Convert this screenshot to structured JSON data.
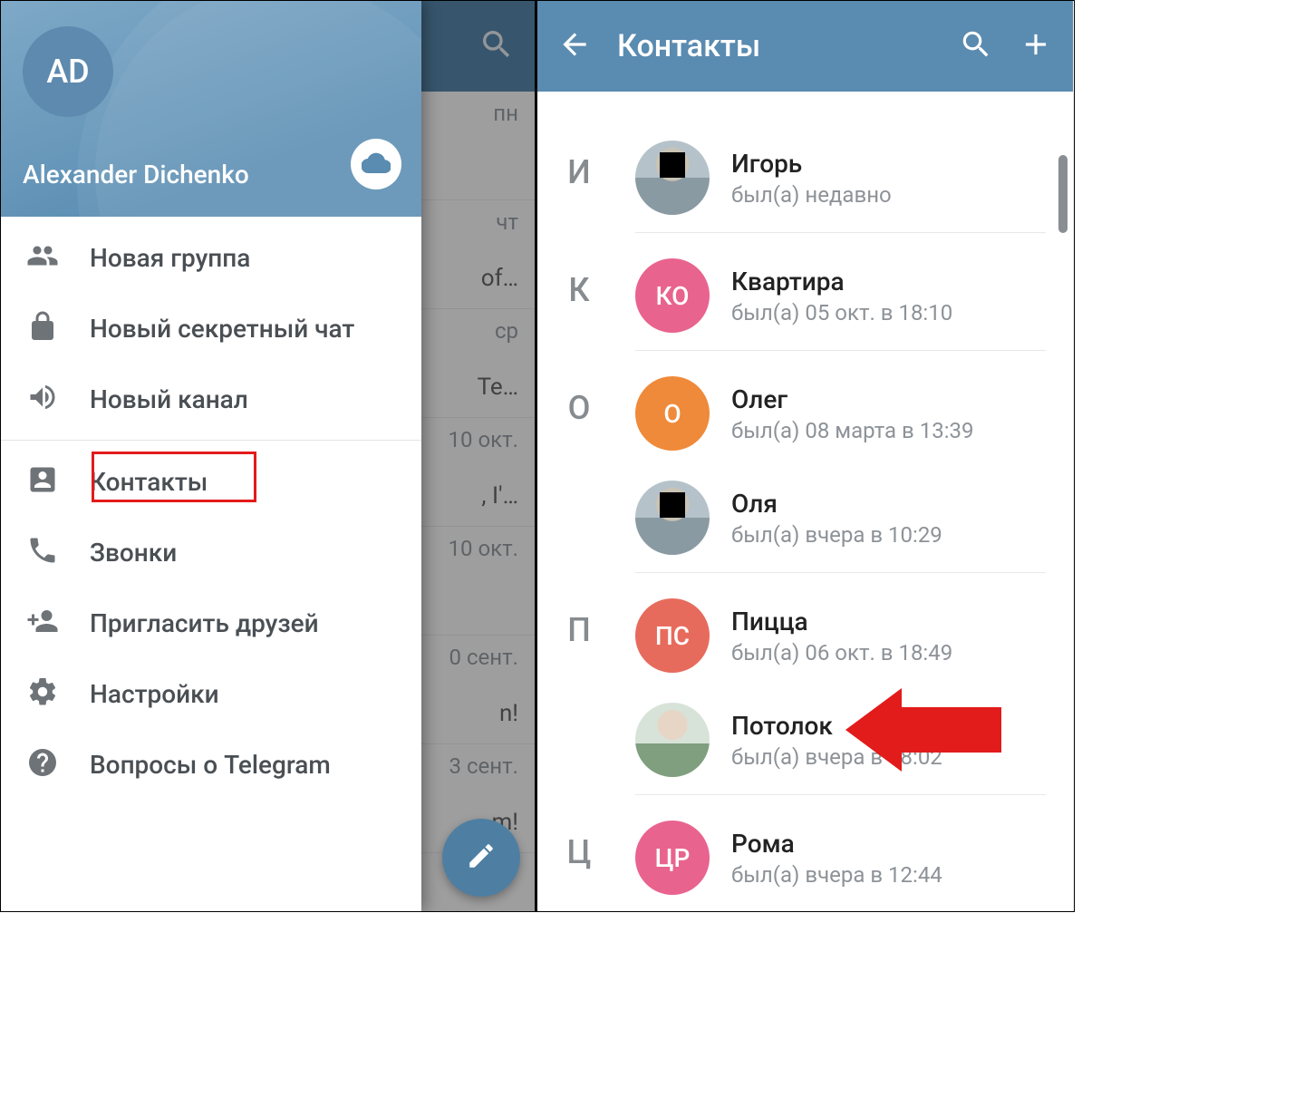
{
  "left": {
    "bg_header": {},
    "bg_rows": [
      {
        "date": "пн",
        "snip": ""
      },
      {
        "date": "чт",
        "snip": "of…"
      },
      {
        "date": "ср",
        "snip": "Te…"
      },
      {
        "date": "10 окт.",
        "snip": ", I'…"
      },
      {
        "date": "10 окт.",
        "snip": ""
      },
      {
        "date": "0 сент.",
        "snip": "n!"
      },
      {
        "date": "3 сент.",
        "snip": "m!"
      }
    ],
    "drawer": {
      "avatar_initials": "AD",
      "username": "Alexander Dichenko",
      "items": [
        {
          "icon": "group",
          "label": "Новая группа"
        },
        {
          "icon": "lock",
          "label": "Новый секретный чат"
        },
        {
          "icon": "megaphone",
          "label": "Новый канал"
        },
        {
          "icon": "contact",
          "label": "Контакты",
          "highlighted": true
        },
        {
          "icon": "phone",
          "label": "Звонки"
        },
        {
          "icon": "invite",
          "label": "Пригласить друзей"
        },
        {
          "icon": "settings",
          "label": "Настройки"
        },
        {
          "icon": "help",
          "label": "Вопросы о Telegram"
        }
      ]
    }
  },
  "right": {
    "header_title": "Контакты",
    "contacts": [
      {
        "letter": "И",
        "name": "Игорь",
        "status": "был(а) недавно",
        "avatar": {
          "type": "photo"
        }
      },
      {
        "letter": "К",
        "name": "Квартира",
        "status": "был(а) 05 окт. в 18:10",
        "avatar": {
          "type": "initials",
          "text": "КО",
          "color": "#e9638f"
        }
      },
      {
        "letter": "О",
        "name": "Олег",
        "status": "был(а) 08 марта в 13:39",
        "avatar": {
          "type": "initials",
          "text": "О",
          "color": "#ef8a3a"
        }
      },
      {
        "letter": "",
        "name": "Оля",
        "status": "был(а) вчера в 10:29",
        "avatar": {
          "type": "photo"
        }
      },
      {
        "letter": "П",
        "name": "Пицца",
        "status": "был(а) 06 окт. в 18:49",
        "avatar": {
          "type": "initials",
          "text": "ПС",
          "color": "#e76b5c"
        }
      },
      {
        "letter": "",
        "name": "Потолок",
        "status": "был(а) вчера в 18:02",
        "avatar": {
          "type": "photo2"
        },
        "arrow": true
      },
      {
        "letter": "Ц",
        "name": "Рома",
        "status": "был(а) вчера в 12:44",
        "avatar": {
          "type": "initials",
          "text": "ЦР",
          "color": "#e9638f"
        }
      }
    ]
  }
}
